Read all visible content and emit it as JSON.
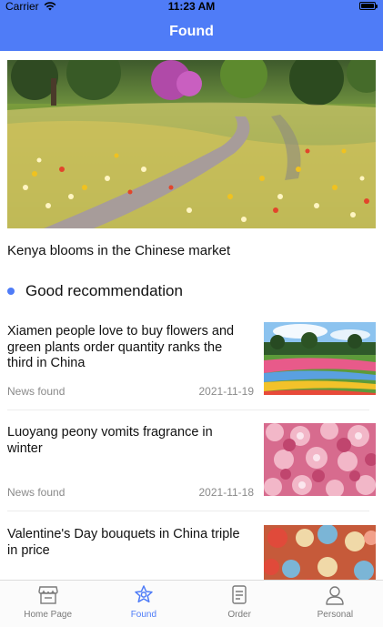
{
  "status_bar": {
    "carrier": "Carrier",
    "time": "11:23 AM"
  },
  "nav": {
    "title": "Found"
  },
  "hero": {
    "caption": "Kenya blooms in the Chinese market"
  },
  "section": {
    "title": "Good recommendation"
  },
  "news": [
    {
      "title": "Xiamen people love to buy flowers and green plants order quantity ranks the third in China",
      "source": "News found",
      "date": "2021-11-19"
    },
    {
      "title": "Luoyang peony vomits fragrance in winter",
      "source": "News found",
      "date": "2021-11-18"
    },
    {
      "title": "Valentine's Day bouquets in China triple in price",
      "source": "",
      "date": ""
    }
  ],
  "tabs": [
    {
      "label": "Home Page",
      "icon": "home-icon",
      "active": false
    },
    {
      "label": "Found",
      "icon": "flower-icon",
      "active": true
    },
    {
      "label": "Order",
      "icon": "order-icon",
      "active": false
    },
    {
      "label": "Personal",
      "icon": "person-icon",
      "active": false
    }
  ],
  "colors": {
    "accent": "#4f7cf7",
    "muted_text": "#8a8a8a",
    "background": "#ffffff"
  }
}
